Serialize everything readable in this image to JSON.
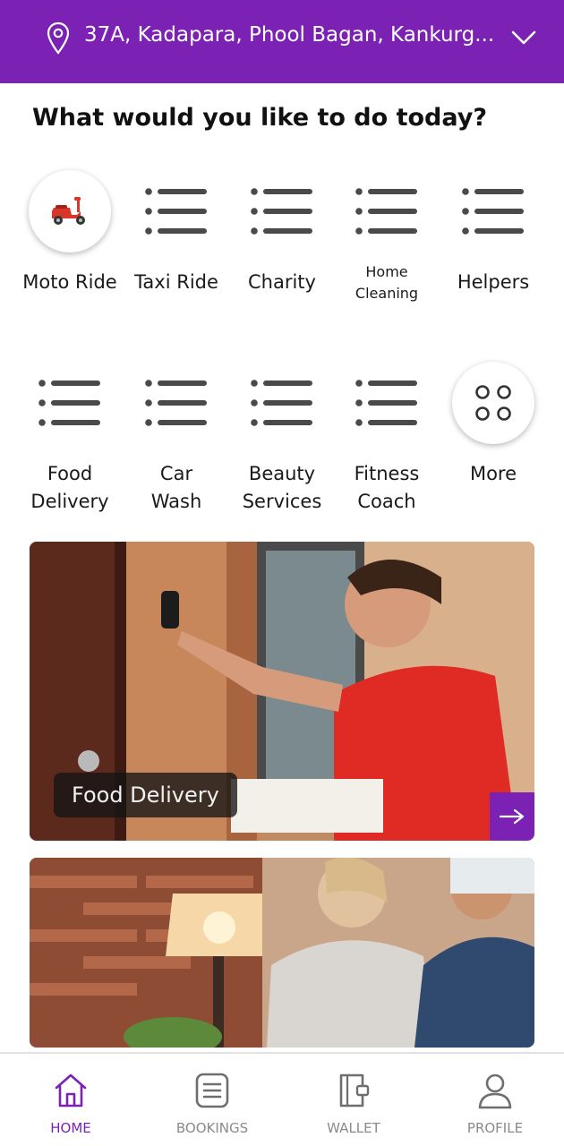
{
  "header": {
    "address": "37A, Kadapara, Phool Bagan, Kankurg...",
    "location_icon": "location-pin-icon",
    "dropdown_icon": "chevron-down-icon"
  },
  "title": "What would you like to do today?",
  "services": [
    {
      "label": "Moto Ride",
      "icon": "scooter-icon"
    },
    {
      "label": "Taxi Ride",
      "icon": "list-icon"
    },
    {
      "label": "Charity",
      "icon": "list-icon"
    },
    {
      "label": "Home Cleaning",
      "icon": "list-icon"
    },
    {
      "label": "Helpers",
      "icon": "list-icon"
    },
    {
      "label": "Food Delivery",
      "icon": "list-icon"
    },
    {
      "label": "Car Wash",
      "icon": "list-icon"
    },
    {
      "label": "Beauty Services",
      "icon": "list-icon"
    },
    {
      "label": "Fitness Coach",
      "icon": "list-icon"
    },
    {
      "label": "More",
      "icon": "grid-dots-icon"
    }
  ],
  "banners": [
    {
      "label": "Food Delivery",
      "arrow_icon": "arrow-right-icon"
    },
    {
      "label": ""
    }
  ],
  "bottom_nav": [
    {
      "label": "HOME",
      "icon": "home-icon",
      "active": true
    },
    {
      "label": "BOOKINGS",
      "icon": "bookings-icon",
      "active": false
    },
    {
      "label": "WALLET",
      "icon": "wallet-icon",
      "active": false
    },
    {
      "label": "PROFILE",
      "icon": "profile-icon",
      "active": false
    }
  ],
  "colors": {
    "brand": "#7b22b4",
    "icon_gray": "#4a4a4a",
    "scooter_red": "#d9362b"
  }
}
